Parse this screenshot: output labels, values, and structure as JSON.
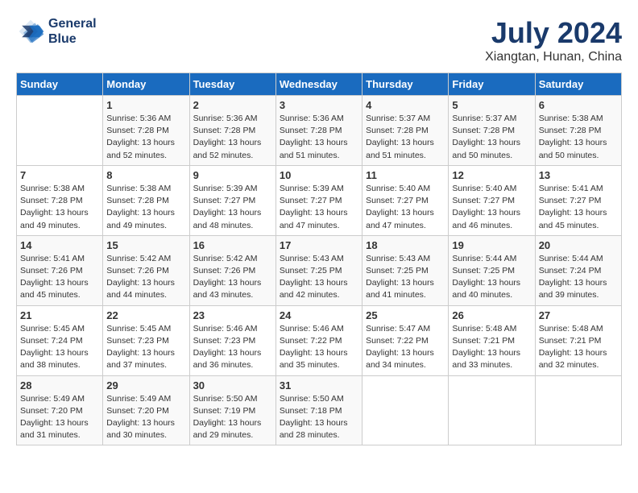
{
  "header": {
    "logo_line1": "General",
    "logo_line2": "Blue",
    "month_year": "July 2024",
    "location": "Xiangtan, Hunan, China"
  },
  "columns": [
    "Sunday",
    "Monday",
    "Tuesday",
    "Wednesday",
    "Thursday",
    "Friday",
    "Saturday"
  ],
  "weeks": [
    [
      {
        "day": "",
        "info": ""
      },
      {
        "day": "1",
        "info": "Sunrise: 5:36 AM\nSunset: 7:28 PM\nDaylight: 13 hours\nand 52 minutes."
      },
      {
        "day": "2",
        "info": "Sunrise: 5:36 AM\nSunset: 7:28 PM\nDaylight: 13 hours\nand 52 minutes."
      },
      {
        "day": "3",
        "info": "Sunrise: 5:36 AM\nSunset: 7:28 PM\nDaylight: 13 hours\nand 51 minutes."
      },
      {
        "day": "4",
        "info": "Sunrise: 5:37 AM\nSunset: 7:28 PM\nDaylight: 13 hours\nand 51 minutes."
      },
      {
        "day": "5",
        "info": "Sunrise: 5:37 AM\nSunset: 7:28 PM\nDaylight: 13 hours\nand 50 minutes."
      },
      {
        "day": "6",
        "info": "Sunrise: 5:38 AM\nSunset: 7:28 PM\nDaylight: 13 hours\nand 50 minutes."
      }
    ],
    [
      {
        "day": "7",
        "info": "Sunrise: 5:38 AM\nSunset: 7:28 PM\nDaylight: 13 hours\nand 49 minutes."
      },
      {
        "day": "8",
        "info": "Sunrise: 5:38 AM\nSunset: 7:28 PM\nDaylight: 13 hours\nand 49 minutes."
      },
      {
        "day": "9",
        "info": "Sunrise: 5:39 AM\nSunset: 7:27 PM\nDaylight: 13 hours\nand 48 minutes."
      },
      {
        "day": "10",
        "info": "Sunrise: 5:39 AM\nSunset: 7:27 PM\nDaylight: 13 hours\nand 47 minutes."
      },
      {
        "day": "11",
        "info": "Sunrise: 5:40 AM\nSunset: 7:27 PM\nDaylight: 13 hours\nand 47 minutes."
      },
      {
        "day": "12",
        "info": "Sunrise: 5:40 AM\nSunset: 7:27 PM\nDaylight: 13 hours\nand 46 minutes."
      },
      {
        "day": "13",
        "info": "Sunrise: 5:41 AM\nSunset: 7:27 PM\nDaylight: 13 hours\nand 45 minutes."
      }
    ],
    [
      {
        "day": "14",
        "info": "Sunrise: 5:41 AM\nSunset: 7:26 PM\nDaylight: 13 hours\nand 45 minutes."
      },
      {
        "day": "15",
        "info": "Sunrise: 5:42 AM\nSunset: 7:26 PM\nDaylight: 13 hours\nand 44 minutes."
      },
      {
        "day": "16",
        "info": "Sunrise: 5:42 AM\nSunset: 7:26 PM\nDaylight: 13 hours\nand 43 minutes."
      },
      {
        "day": "17",
        "info": "Sunrise: 5:43 AM\nSunset: 7:25 PM\nDaylight: 13 hours\nand 42 minutes."
      },
      {
        "day": "18",
        "info": "Sunrise: 5:43 AM\nSunset: 7:25 PM\nDaylight: 13 hours\nand 41 minutes."
      },
      {
        "day": "19",
        "info": "Sunrise: 5:44 AM\nSunset: 7:25 PM\nDaylight: 13 hours\nand 40 minutes."
      },
      {
        "day": "20",
        "info": "Sunrise: 5:44 AM\nSunset: 7:24 PM\nDaylight: 13 hours\nand 39 minutes."
      }
    ],
    [
      {
        "day": "21",
        "info": "Sunrise: 5:45 AM\nSunset: 7:24 PM\nDaylight: 13 hours\nand 38 minutes."
      },
      {
        "day": "22",
        "info": "Sunrise: 5:45 AM\nSunset: 7:23 PM\nDaylight: 13 hours\nand 37 minutes."
      },
      {
        "day": "23",
        "info": "Sunrise: 5:46 AM\nSunset: 7:23 PM\nDaylight: 13 hours\nand 36 minutes."
      },
      {
        "day": "24",
        "info": "Sunrise: 5:46 AM\nSunset: 7:22 PM\nDaylight: 13 hours\nand 35 minutes."
      },
      {
        "day": "25",
        "info": "Sunrise: 5:47 AM\nSunset: 7:22 PM\nDaylight: 13 hours\nand 34 minutes."
      },
      {
        "day": "26",
        "info": "Sunrise: 5:48 AM\nSunset: 7:21 PM\nDaylight: 13 hours\nand 33 minutes."
      },
      {
        "day": "27",
        "info": "Sunrise: 5:48 AM\nSunset: 7:21 PM\nDaylight: 13 hours\nand 32 minutes."
      }
    ],
    [
      {
        "day": "28",
        "info": "Sunrise: 5:49 AM\nSunset: 7:20 PM\nDaylight: 13 hours\nand 31 minutes."
      },
      {
        "day": "29",
        "info": "Sunrise: 5:49 AM\nSunset: 7:20 PM\nDaylight: 13 hours\nand 30 minutes."
      },
      {
        "day": "30",
        "info": "Sunrise: 5:50 AM\nSunset: 7:19 PM\nDaylight: 13 hours\nand 29 minutes."
      },
      {
        "day": "31",
        "info": "Sunrise: 5:50 AM\nSunset: 7:18 PM\nDaylight: 13 hours\nand 28 minutes."
      },
      {
        "day": "",
        "info": ""
      },
      {
        "day": "",
        "info": ""
      },
      {
        "day": "",
        "info": ""
      }
    ]
  ]
}
